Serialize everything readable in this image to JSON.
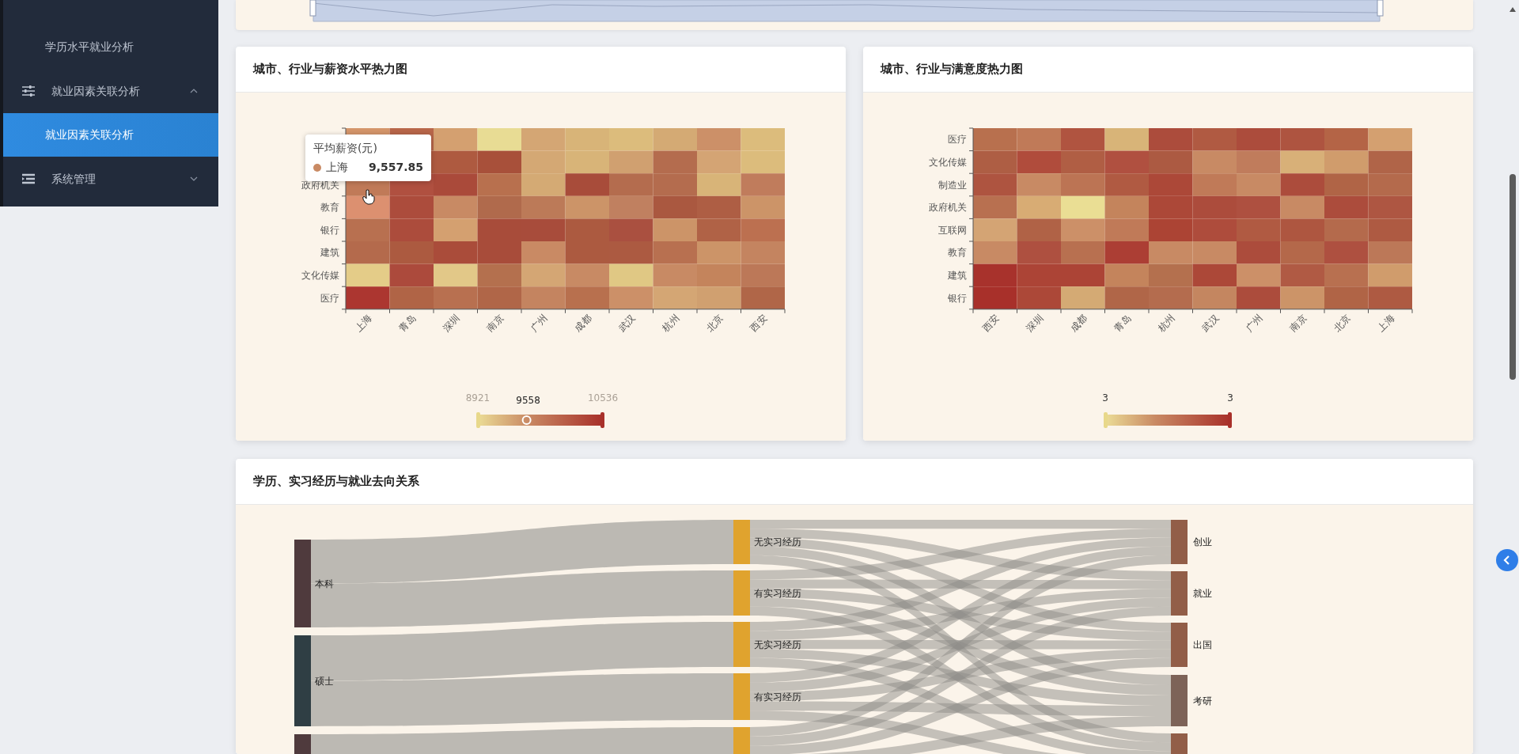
{
  "sidebar": {
    "items": [
      {
        "kind": "sub",
        "label": "学历水平就业分析",
        "selected": false
      },
      {
        "kind": "group",
        "label": "就业因素关联分析",
        "expanded": true
      },
      {
        "kind": "sub",
        "label": "就业因素关联分析",
        "selected": true
      },
      {
        "kind": "group",
        "label": "系统管理",
        "expanded": false
      }
    ]
  },
  "heatmaps": [
    {
      "title": "城市、行业与薪资水平热力图",
      "x_labels": [
        "上海",
        "青岛",
        "深圳",
        "南京",
        "广州",
        "成都",
        "武汉",
        "杭州",
        "北京",
        "西安"
      ],
      "rows": [
        {
          "cells": [
            {
              "color": "#d4956a"
            },
            {
              "color": "#b8664a"
            },
            {
              "color": "#d4a070"
            },
            {
              "color": "#e8dc94"
            },
            {
              "color": "#d4a674"
            },
            {
              "color": "#d8b478"
            },
            {
              "color": "#dcbc7c"
            },
            {
              "color": "#d4aa74"
            },
            {
              "color": "#cc9068"
            },
            {
              "color": "#dcbc7c"
            }
          ]
        },
        {
          "cells": [
            {},
            {
              "color": "#b05a40"
            },
            {
              "color": "#ae5a40"
            },
            {
              "color": "#a8503a"
            },
            {
              "color": "#d4a874"
            },
            {
              "color": "#d8b478"
            },
            {
              "color": "#d0a070"
            },
            {
              "color": "#b46c4e"
            },
            {
              "color": "#d4a474"
            },
            {
              "color": "#dcbc7c"
            }
          ]
        },
        {
          "label": "政府机关",
          "cells": [
            {
              "color": "#c07a58"
            },
            {
              "color": "#b05040"
            },
            {
              "color": "#aa4a3a"
            },
            {
              "color": "#b8704e"
            },
            {
              "color": "#d4aa74"
            },
            {
              "color": "#a84c3a"
            },
            {
              "color": "#b46c4e"
            },
            {
              "color": "#b46c4e"
            },
            {
              "color": "#d8b478"
            },
            {
              "color": "#c07c5c"
            }
          ]
        },
        {
          "label": "教育",
          "cells": [
            {
              "color": "#dc9070"
            },
            {
              "color": "#ac4c3c"
            },
            {
              "color": "#c88a64"
            },
            {
              "color": "#b06a4c"
            },
            {
              "color": "#bc7a58"
            },
            {
              "color": "#cc9468"
            },
            {
              "color": "#c08060"
            },
            {
              "color": "#aa5840"
            },
            {
              "color": "#ae5e44"
            },
            {
              "color": "#cc9468"
            }
          ]
        },
        {
          "label": "银行",
          "cells": [
            {
              "color": "#b87050"
            },
            {
              "color": "#ac4c3c"
            },
            {
              "color": "#d4a070"
            },
            {
              "color": "#a84c3a"
            },
            {
              "color": "#a84c3b"
            },
            {
              "color": "#ac5a40"
            },
            {
              "color": "#aa5040"
            },
            {
              "color": "#cc9468"
            },
            {
              "color": "#b06246"
            },
            {
              "color": "#bc7050"
            }
          ]
        },
        {
          "label": "建筑",
          "cells": [
            {
              "color": "#b46a4c"
            },
            {
              "color": "#ac5a40"
            },
            {
              "color": "#aa4c3a"
            },
            {
              "color": "#a84c3a"
            },
            {
              "color": "#c98a64"
            },
            {
              "color": "#ac5a40"
            },
            {
              "color": "#ac5a41"
            },
            {
              "color": "#b87050"
            },
            {
              "color": "#cc9468"
            },
            {
              "color": "#c48460"
            }
          ]
        },
        {
          "label": "文化传媒",
          "cells": [
            {
              "color": "#e4cc88"
            },
            {
              "color": "#ac4a3c"
            },
            {
              "color": "#e2c888"
            },
            {
              "color": "#b4704e"
            },
            {
              "color": "#d4a674"
            },
            {
              "color": "#c88a64"
            },
            {
              "color": "#e0c884"
            },
            {
              "color": "#c88a64"
            },
            {
              "color": "#c4845c"
            },
            {
              "color": "#bc7858"
            }
          ]
        },
        {
          "label": "医疗",
          "cells": [
            {
              "color": "#ac3630"
            },
            {
              "color": "#b06446"
            },
            {
              "color": "#b87050"
            },
            {
              "color": "#b06648"
            },
            {
              "color": "#c48460"
            },
            {
              "color": "#b8704e"
            },
            {
              "color": "#cc9068"
            },
            {
              "color": "#d4a674"
            },
            {
              "color": "#d0a070"
            },
            {
              "color": "#b06648"
            }
          ]
        }
      ],
      "legend": {
        "min": "8921",
        "max": "10536",
        "current": "9558",
        "level": 0.39
      },
      "tooltip": {
        "title": "平均薪资(元)",
        "series": "上海",
        "value": "9,557.85",
        "color": "#c98a64"
      }
    },
    {
      "title": "城市、行业与满意度热力图",
      "x_labels": [
        "西安",
        "深圳",
        "成都",
        "青岛",
        "杭州",
        "武汉",
        "广州",
        "南京",
        "北京",
        "上海"
      ],
      "rows": [
        {
          "label": "医疗",
          "cells": [
            {
              "color": "#b8704e"
            },
            {
              "color": "#c07a58"
            },
            {
              "color": "#b05440"
            },
            {
              "color": "#d8b478"
            },
            {
              "color": "#ac4c3c"
            },
            {
              "color": "#b05a42"
            },
            {
              "color": "#ac4c3c"
            },
            {
              "color": "#ae5440"
            },
            {
              "color": "#b46446"
            },
            {
              "color": "#d4a070"
            }
          ]
        },
        {
          "label": "文化传媒",
          "cells": [
            {
              "color": "#ae5e44"
            },
            {
              "color": "#b04c3c"
            },
            {
              "color": "#b05e44"
            },
            {
              "color": "#b05040"
            },
            {
              "color": "#ac5a42"
            },
            {
              "color": "#c88a64"
            },
            {
              "color": "#c07c5c"
            },
            {
              "color": "#d8b078"
            },
            {
              "color": "#d09c6c"
            },
            {
              "color": "#b06448"
            }
          ]
        },
        {
          "label": "制造业",
          "cells": [
            {
              "color": "#ae5440"
            },
            {
              "color": "#c88a64"
            },
            {
              "color": "#bc7454"
            },
            {
              "color": "#b05a42"
            },
            {
              "color": "#ac4838"
            },
            {
              "color": "#c07a58"
            },
            {
              "color": "#c88a64"
            },
            {
              "color": "#ac4c3c"
            },
            {
              "color": "#b06446"
            },
            {
              "color": "#b46a4c"
            }
          ]
        },
        {
          "label": "政府机关",
          "cells": [
            {
              "color": "#b87050"
            },
            {
              "color": "#d8ac74"
            },
            {
              "color": "#eade94"
            },
            {
              "color": "#c4845c"
            },
            {
              "color": "#ac4838"
            },
            {
              "color": "#ac4c3c"
            },
            {
              "color": "#ae5040"
            },
            {
              "color": "#c88a64"
            },
            {
              "color": "#ac4c3c"
            },
            {
              "color": "#ae5642"
            }
          ]
        },
        {
          "label": "互联网",
          "cells": [
            {
              "color": "#d4a474"
            },
            {
              "color": "#b06246"
            },
            {
              "color": "#cc9068"
            },
            {
              "color": "#c07a58"
            },
            {
              "color": "#ac4434"
            },
            {
              "color": "#ae4c3c"
            },
            {
              "color": "#b05a42"
            },
            {
              "color": "#ae5640"
            },
            {
              "color": "#b46a4c"
            },
            {
              "color": "#ae5a42"
            }
          ]
        },
        {
          "label": "教育",
          "cells": [
            {
              "color": "#c88a64"
            },
            {
              "color": "#ae5040"
            },
            {
              "color": "#b87050"
            },
            {
              "color": "#ac3e34"
            },
            {
              "color": "#c88a64"
            },
            {
              "color": "#c88a64"
            },
            {
              "color": "#ac4c3c"
            },
            {
              "color": "#b4684a"
            },
            {
              "color": "#ae5040"
            },
            {
              "color": "#bc7858"
            }
          ]
        },
        {
          "label": "建筑",
          "cells": [
            {
              "color": "#a8322c"
            },
            {
              "color": "#ac4436"
            },
            {
              "color": "#ac4436"
            },
            {
              "color": "#c4845c"
            },
            {
              "color": "#b4704e"
            },
            {
              "color": "#ac4838"
            },
            {
              "color": "#cc9068"
            },
            {
              "color": "#b05a44"
            },
            {
              "color": "#b87050"
            },
            {
              "color": "#d09c6c"
            }
          ]
        },
        {
          "label": "银行",
          "cells": [
            {
              "color": "#a8302a"
            },
            {
              "color": "#ac4838"
            },
            {
              "color": "#d4aa74"
            },
            {
              "color": "#b06648"
            },
            {
              "color": "#b46c4e"
            },
            {
              "color": "#c48660"
            },
            {
              "color": "#ac4c3c"
            },
            {
              "color": "#cc9468"
            },
            {
              "color": "#b06446"
            },
            {
              "color": "#ae5a42"
            }
          ]
        }
      ],
      "legend": {
        "min": "3",
        "max": "3"
      }
    }
  ],
  "sankey": {
    "title": "学历、实习经历与就业去向关系",
    "sources": [
      {
        "label": "本科"
      },
      {
        "label": "硕士"
      }
    ],
    "stages": [
      {
        "label": "无实习经历"
      },
      {
        "label": "有实习经历"
      },
      {
        "label": "无实习经历"
      },
      {
        "label": "有实习经历"
      }
    ],
    "targets": [
      {
        "label": "创业"
      },
      {
        "label": "就业"
      },
      {
        "label": "出国"
      },
      {
        "label": "考研"
      }
    ]
  }
}
